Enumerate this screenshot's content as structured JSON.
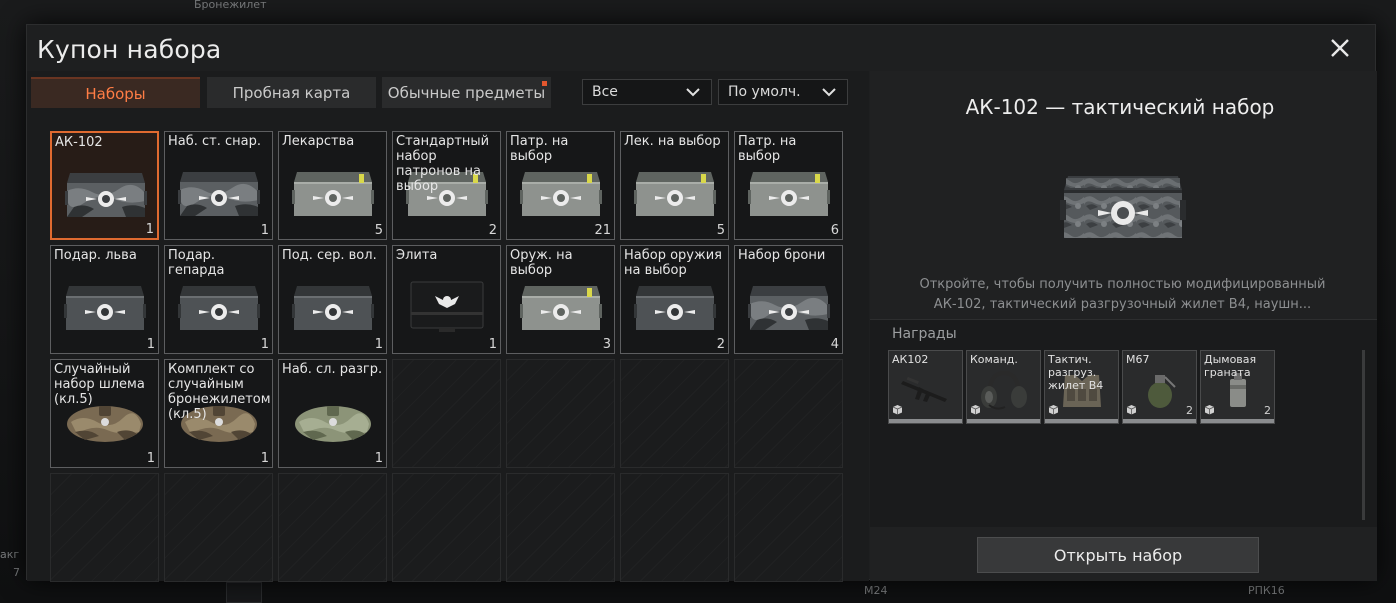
{
  "background": {
    "top_label": "Бронежилет",
    "left_hint": "акг",
    "left_number": "7",
    "bottom_labels": [
      "M24",
      "РПК16"
    ]
  },
  "dialog": {
    "title": "Купон набора",
    "close_icon": "close-icon"
  },
  "tabs": [
    {
      "label": "Наборы",
      "active": true
    },
    {
      "label": "Пробная карта",
      "active": false
    },
    {
      "label": "Обычные предметы",
      "active": false,
      "badge": true
    }
  ],
  "filters": {
    "category": "Все",
    "sort": "По умолч."
  },
  "items": [
    {
      "label": "АК-102",
      "count": "1",
      "art": "camo-crate",
      "selected": true
    },
    {
      "label": "Наб. ст. снар.",
      "count": "1",
      "art": "camo-crate"
    },
    {
      "label": "Лекарства",
      "count": "5",
      "art": "green-crate-med"
    },
    {
      "label": "Стандартный набор патронов на выбор",
      "count": "2",
      "art": "green-crate-ammo"
    },
    {
      "label": "Патр. на выбор",
      "count": "21",
      "art": "green-crate-ammo"
    },
    {
      "label": "Лек. на выбор",
      "count": "5",
      "art": "green-crate-med"
    },
    {
      "label": "Патр. на выбор",
      "count": "6",
      "art": "green-crate-ammo"
    },
    {
      "label": "Подар. льва",
      "count": "1",
      "art": "grey-crate"
    },
    {
      "label": "Подар. гепарда",
      "count": "1",
      "art": "grey-crate"
    },
    {
      "label": "Под. сер. вол.",
      "count": "1",
      "art": "grey-crate"
    },
    {
      "label": "Элита",
      "count": "1",
      "art": "black-case"
    },
    {
      "label": "Оруж. на выбор",
      "count": "3",
      "art": "green-crate-ammo"
    },
    {
      "label": "Набор оружия на выбор",
      "count": "2",
      "art": "grey-crate"
    },
    {
      "label": "Набор брони",
      "count": "4",
      "art": "camo-crate"
    },
    {
      "label": "Случайный набор шлема (кл.5)",
      "count": "1",
      "art": "duffel-bag"
    },
    {
      "label": "Комплект со случайным бронежилетом (кл.5)",
      "count": "1",
      "art": "duffel-bag"
    },
    {
      "label": "Наб. сл. разгр.",
      "count": "1",
      "art": "duffel-bag-green"
    }
  ],
  "details": {
    "title": "АК-102 — тактический набор",
    "description": "Откройте, чтобы получить полностью модифицированный АК-102, тактический разгрузочный жилет В4, наушн...",
    "rewards_label": "Награды",
    "rewards": [
      {
        "name": "АК102",
        "count": "",
        "art": "rifle-icon"
      },
      {
        "name": "Команд.",
        "count": "",
        "art": "headset-icon"
      },
      {
        "name": "Тактич. разгруз. жилет В4",
        "count": "",
        "art": "vest-icon"
      },
      {
        "name": "М67",
        "count": "2",
        "art": "grenade-icon"
      },
      {
        "name": "Дымовая граната",
        "count": "2",
        "art": "smoke-grenade-icon"
      }
    ],
    "open_button": "Открыть набор"
  },
  "colors": {
    "accent": "#e06a30",
    "tab_active_text": "#ff7d45",
    "panel": "#1e1f20"
  }
}
